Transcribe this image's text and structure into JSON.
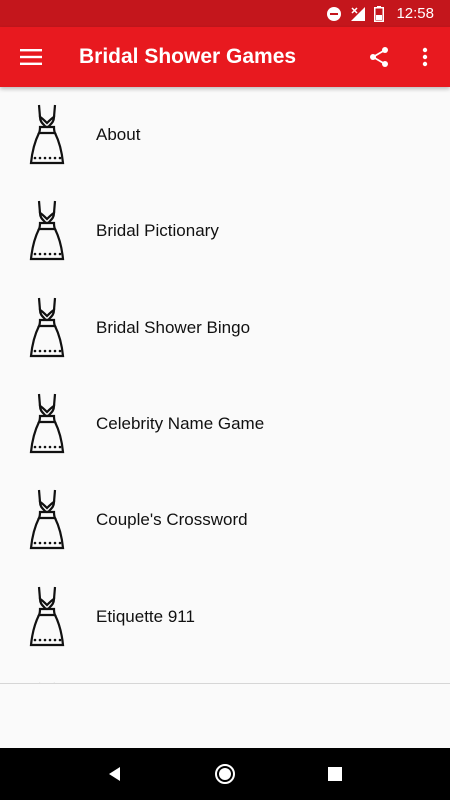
{
  "status_bar": {
    "time": "12:58",
    "icons": [
      "do-not-disturb-icon",
      "no-signal-icon",
      "battery-icon"
    ]
  },
  "app_bar": {
    "title": "Bridal Shower Games",
    "left_icon": "hamburger-menu-icon",
    "actions": [
      "share-icon",
      "overflow-menu-icon"
    ],
    "color": "#e8191f",
    "status_color": "#c4161c"
  },
  "list": {
    "item_icon": "dress-icon",
    "items": [
      {
        "label": "About"
      },
      {
        "label": "Bridal Pictionary"
      },
      {
        "label": "Bridal Shower Bingo"
      },
      {
        "label": "Celebrity Name Game"
      },
      {
        "label": "Couple's Crossword"
      },
      {
        "label": "Etiquette 911"
      }
    ]
  },
  "nav_bar": {
    "buttons": [
      "back-icon",
      "home-icon",
      "recents-icon"
    ]
  }
}
